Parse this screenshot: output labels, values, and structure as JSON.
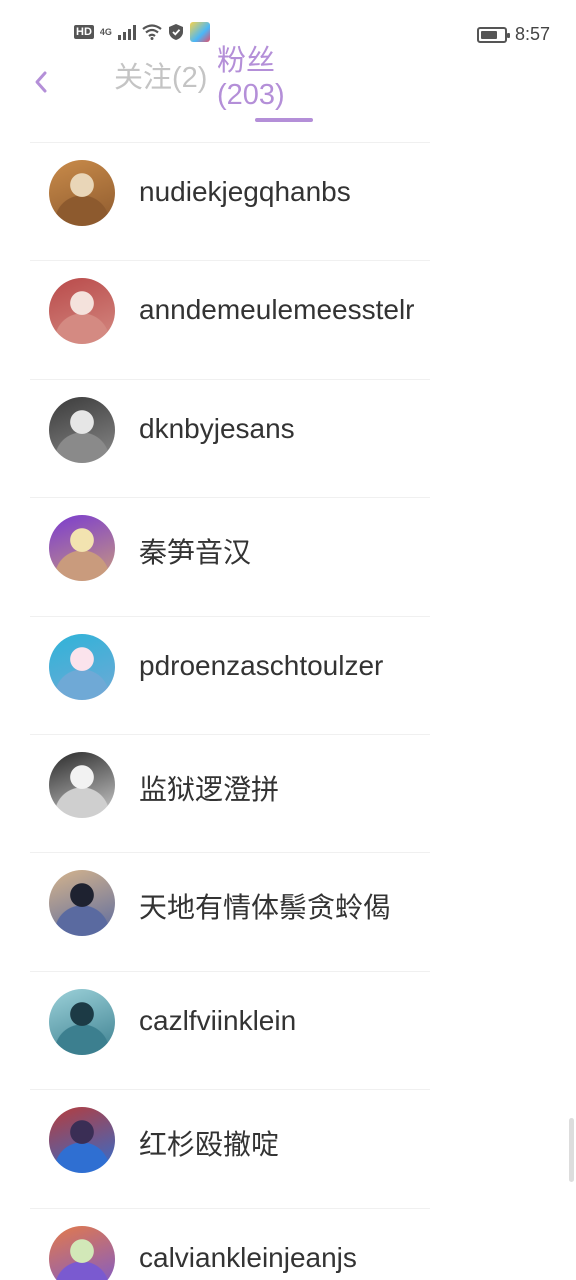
{
  "status_bar": {
    "hd": "HD",
    "network": "4G",
    "time": "8:57",
    "battery_level": 0.75
  },
  "header": {
    "back_icon": "chevron-left-icon",
    "tabs": [
      {
        "label": "关注",
        "count": "(2)",
        "active": false
      },
      {
        "label": "粉丝",
        "count": "(203)",
        "active": true
      }
    ],
    "accent_color": "#b48fd8",
    "inactive_color": "#c4c4c4"
  },
  "followers": [
    {
      "name": "nudiekjegqhanbs"
    },
    {
      "name": "anndemeulemeesstelr"
    },
    {
      "name": "dknbyjesans"
    },
    {
      "name": "秦笋音汉"
    },
    {
      "name": "pdroenzaschtoulzer"
    },
    {
      "name": "监狱逻澄拼"
    },
    {
      "name": "天地有情体鬃贪蛉偈"
    },
    {
      "name": "cazlfviinklein"
    },
    {
      "name": "红杉殴撤啶"
    },
    {
      "name": "calviankleinjeanjs"
    }
  ]
}
